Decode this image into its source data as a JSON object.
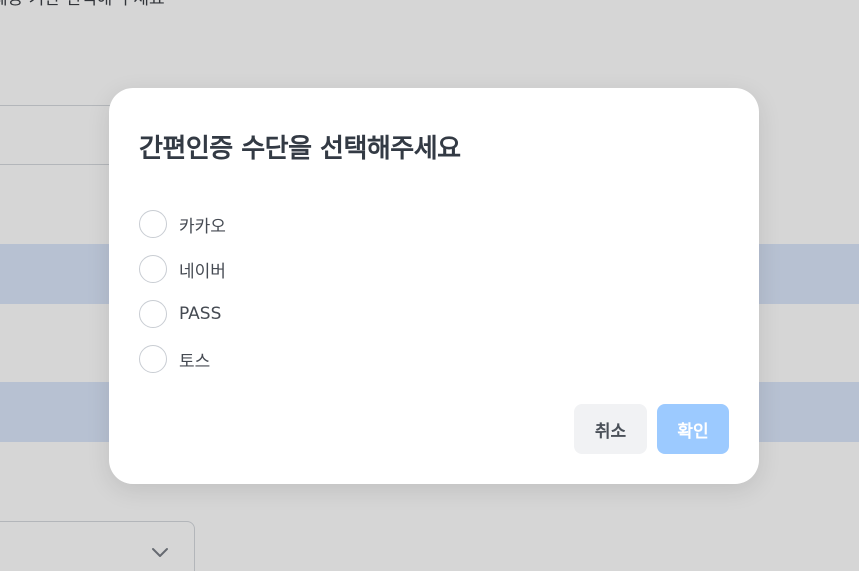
{
  "background": {
    "heading_fragment": "제공 기관 선택해 주세요",
    "select_chevron_icon": "chevron-down-icon"
  },
  "modal": {
    "title": "간편인증 수단을 선택해주세요",
    "options": [
      {
        "label": "카카오",
        "selected": false
      },
      {
        "label": "네이버",
        "selected": false
      },
      {
        "label": "PASS",
        "selected": false
      },
      {
        "label": "토스",
        "selected": false
      }
    ],
    "buttons": {
      "cancel_label": "취소",
      "confirm_label": "확인",
      "confirm_enabled": false
    }
  },
  "colors": {
    "confirm_disabled": "#9ccaff",
    "cancel_bg": "#f1f2f4",
    "title_text": "#333a44",
    "highlight_band": "#dbe6fb"
  }
}
